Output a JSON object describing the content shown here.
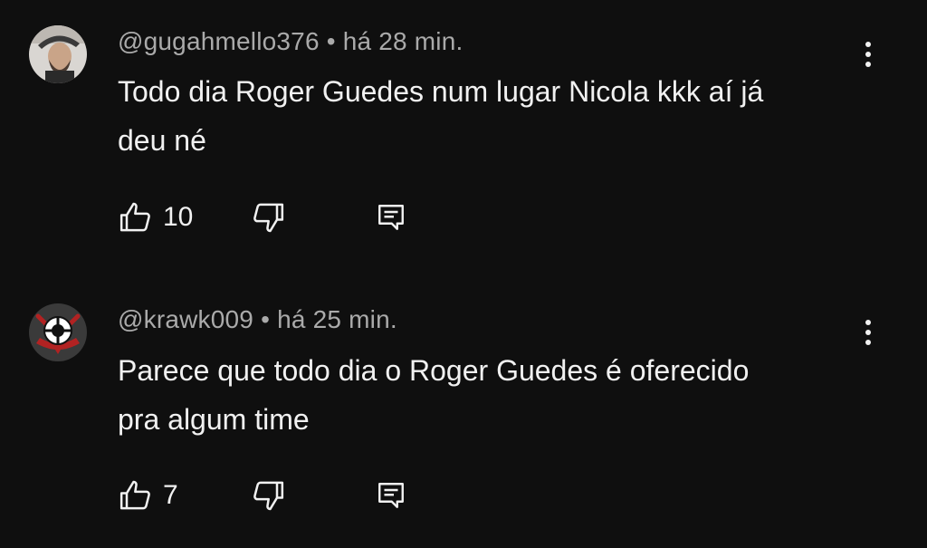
{
  "comments": [
    {
      "author": "@gugahmello376",
      "separator": "•",
      "time": "há 28 min.",
      "text_line1": "Todo dia Roger Guedes num lugar Nicola kkk aí já",
      "text_line2": "deu né",
      "likes": "10",
      "avatar": "person-photo-avatar",
      "menu_icon": "more-vert-icon",
      "like_icon": "thumb-up-icon",
      "dislike_icon": "thumb-down-icon",
      "reply_icon": "reply-comment-icon"
    },
    {
      "author": "@krawk009",
      "separator": "•",
      "time": "há 25 min.",
      "text_line1": "Parece que todo dia o Roger Guedes é oferecido",
      "text_line2": "pra algum time",
      "likes": "7",
      "avatar": "corinthians-crest-avatar",
      "menu_icon": "more-vert-icon",
      "like_icon": "thumb-up-icon",
      "dislike_icon": "thumb-down-icon",
      "reply_icon": "reply-comment-icon"
    }
  ],
  "colors": {
    "background": "#0f0f0f",
    "text": "#f1f1f1",
    "meta": "#aaaaaa"
  }
}
